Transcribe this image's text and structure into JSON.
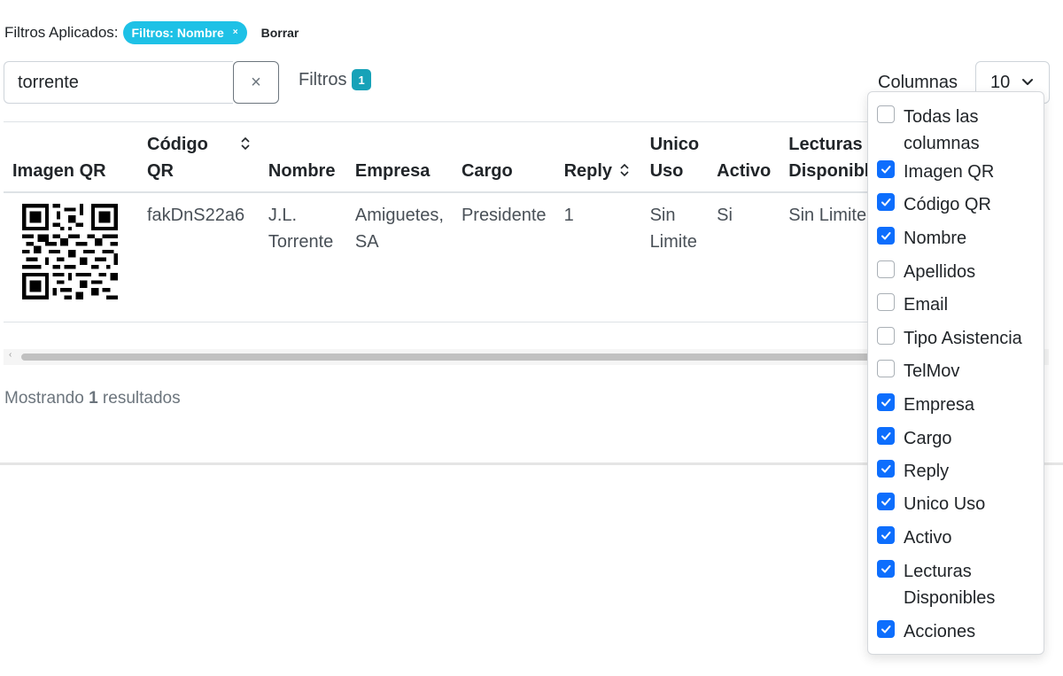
{
  "filters": {
    "label": "Filtros Aplicados:",
    "chip_label": "Filtros: Nombre",
    "chip_close": "×",
    "clear_label": "Borrar"
  },
  "search": {
    "value": "torrente",
    "clear_icon": "×"
  },
  "filters_toggle": {
    "label": "Filtros",
    "count": "1"
  },
  "columns": {
    "label": "Columnas"
  },
  "page_size": {
    "value": "10"
  },
  "table": {
    "headers": [
      {
        "line1": "Imagen QR",
        "line2": ""
      },
      {
        "line1": "Código",
        "line2": "QR"
      },
      {
        "line1": "Nombre",
        "line2": ""
      },
      {
        "line1": "Empresa",
        "line2": ""
      },
      {
        "line1": "Cargo",
        "line2": ""
      },
      {
        "line1": "Reply",
        "line2": ""
      },
      {
        "line1": "Unico",
        "line2": "Uso"
      },
      {
        "line1": "Activo",
        "line2": ""
      },
      {
        "line1": "Lecturas",
        "line2": "Disponibles"
      }
    ],
    "rows": [
      {
        "codigo": "fakDnS22a6",
        "nombre_1": "J.L.",
        "nombre_2": "Torrente",
        "empresa_1": "Amiguetes,",
        "empresa_2": "SA",
        "cargo": "Presidente",
        "reply": "1",
        "unico_1": "Sin",
        "unico_2": "Limite",
        "activo": "Si",
        "lecturas": "Sin Limite"
      }
    ]
  },
  "results": {
    "prefix": "Mostrando",
    "count": "1",
    "suffix": "resultados"
  },
  "column_menu": [
    {
      "label": "Todas las columnas",
      "checked": false
    },
    {
      "label": "Imagen QR",
      "checked": true
    },
    {
      "label": "Código QR",
      "checked": true
    },
    {
      "label": "Nombre",
      "checked": true
    },
    {
      "label": "Apellidos",
      "checked": false
    },
    {
      "label": "Email",
      "checked": false
    },
    {
      "label": "Tipo Asistencia",
      "checked": false
    },
    {
      "label": "TelMov",
      "checked": false
    },
    {
      "label": "Empresa",
      "checked": true
    },
    {
      "label": "Cargo",
      "checked": true
    },
    {
      "label": "Reply",
      "checked": true
    },
    {
      "label": "Unico Uso",
      "checked": true
    },
    {
      "label": "Activo",
      "checked": true
    },
    {
      "label": "Lecturas Disponibles",
      "checked": true
    },
    {
      "label": "Acciones",
      "checked": true
    }
  ],
  "colors": {
    "chip": "#1ec1e6",
    "badge": "#17a2b8",
    "checkbox": "#0d6efd"
  },
  "icons": [
    "close-icon",
    "chevron-down-icon",
    "sort-icon",
    "checkmark-icon",
    "qr-code-icon"
  ]
}
